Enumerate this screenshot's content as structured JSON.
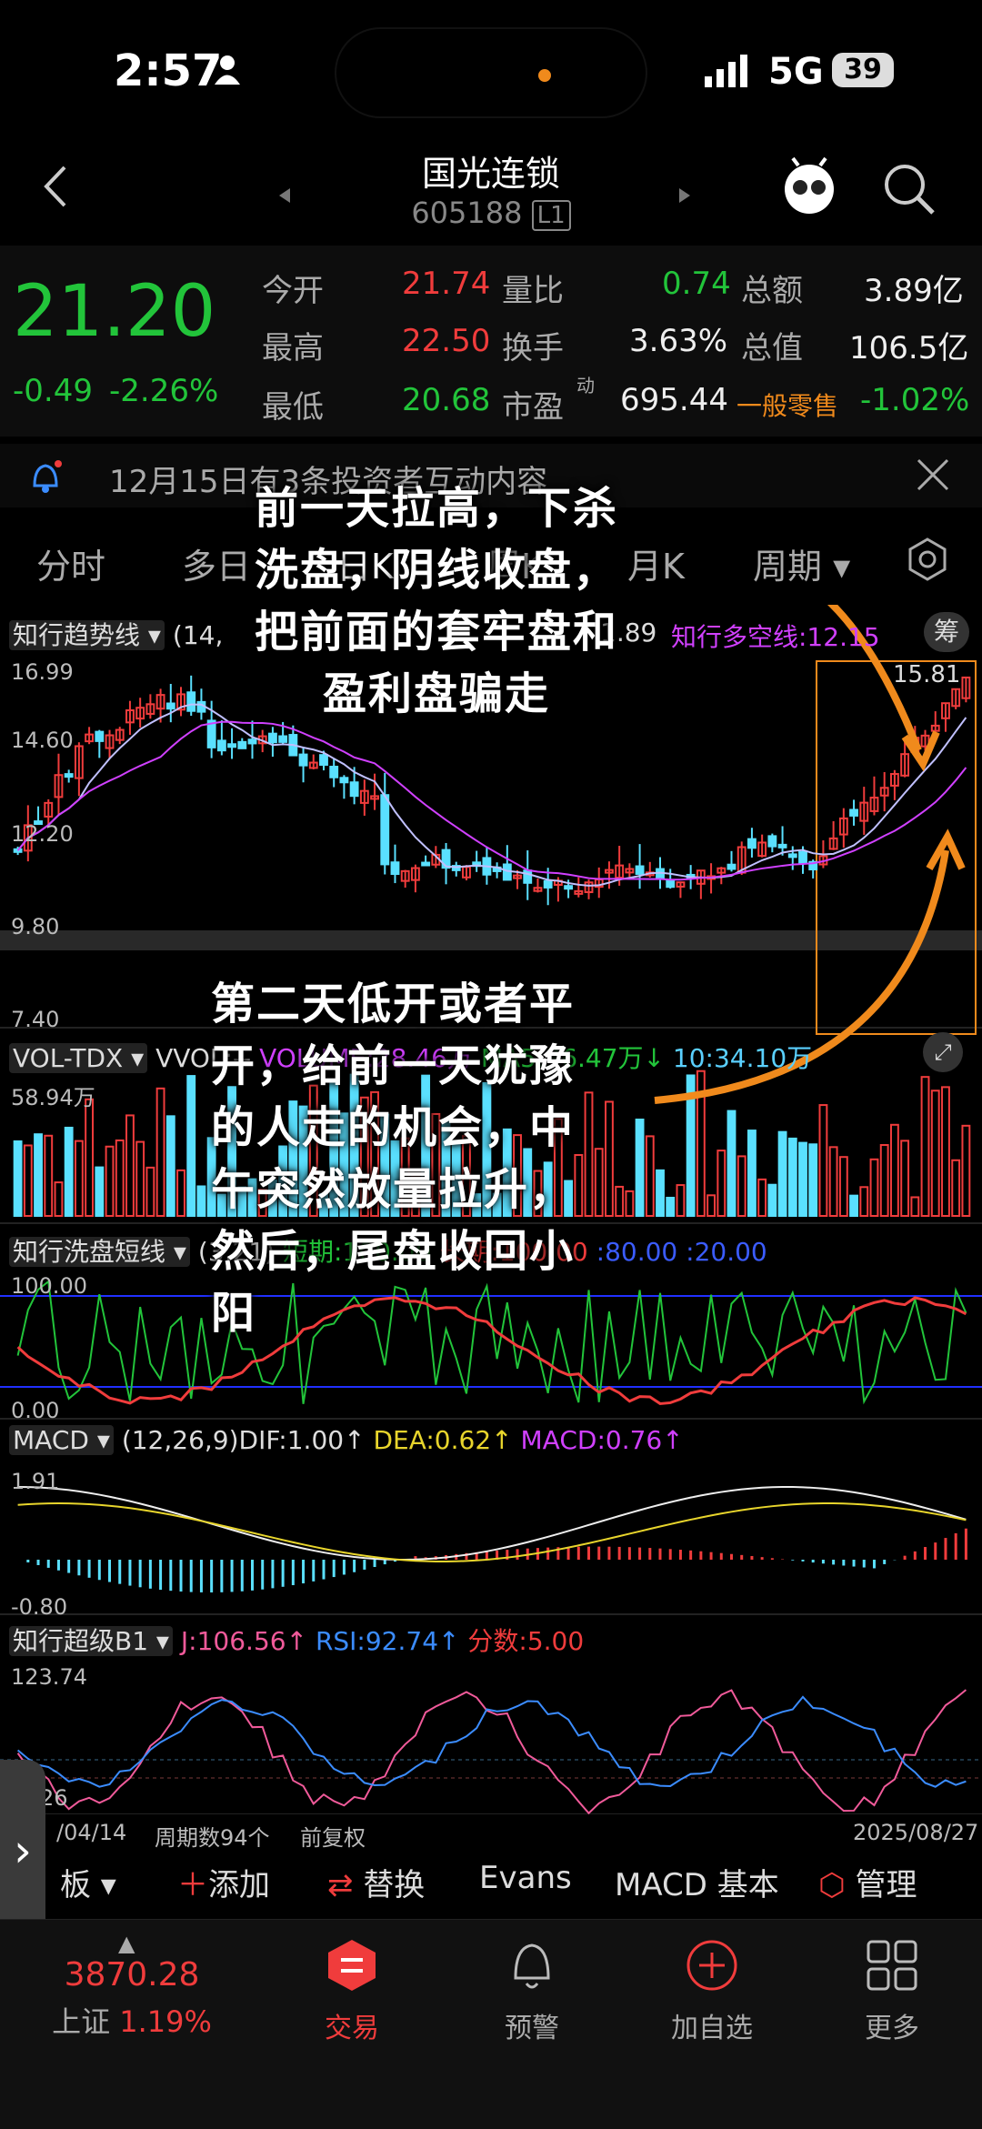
{
  "status": {
    "time": "2:57",
    "network": "5G",
    "battery": "39"
  },
  "header": {
    "title": "国光连锁",
    "code": "605188",
    "level": "L1"
  },
  "quote": {
    "price": "21.20",
    "change": "-0.49",
    "change_pct": "-2.26%",
    "rows": [
      {
        "l1": "今开",
        "v1": "21.74",
        "l2": "量比",
        "v2": "0.74",
        "l3": "总额",
        "v3": "3.89亿"
      },
      {
        "l1": "最高",
        "v1": "22.50",
        "l2": "换手",
        "v2": "3.63%",
        "l3": "总值",
        "v3": "106.5亿"
      },
      {
        "l1": "最低",
        "v1": "20.68",
        "l2": "市盈",
        "v2": "695.44",
        "l3": "一般零售",
        "v3": "-1.02%"
      }
    ],
    "pe_sup": "动"
  },
  "notice": {
    "text": "12月15日有3条投资者互动内容"
  },
  "tabs": [
    "分时",
    "多日",
    "日K",
    "周K",
    "月K",
    "周期"
  ],
  "indicators": {
    "main": {
      "name": "知行趋势线",
      "params": "(14,",
      "vals": "知行多空线:12.15",
      "mid": "1.89"
    },
    "main_axis": [
      "16.99",
      "14.60",
      "12.20",
      "9.80",
      "7.40"
    ],
    "main_high": "15.81",
    "vol": {
      "name": "VOL-TDX",
      "v1": "VVOL:--",
      "v2": "VOLUME:28.46万",
      "v3": "MA5:36.47万↓",
      "v4": "10:34.10万"
    },
    "vol_axis": "58.94万",
    "wash": {
      "name": "知行洗盘短线",
      "params": "(3,21)",
      "v1": "短期:100.00",
      "v2": "长期:100.00",
      "v3": ":80.00",
      "v4": ":20.00"
    },
    "wash_axis": [
      "100.00",
      "0.00"
    ],
    "macd": {
      "name": "MACD",
      "params": "(12,26,9)",
      "v1": "DIF:1.00↑",
      "v2": "DEA:0.62↑",
      "v3": "MACD:0.76↑"
    },
    "macd_axis": [
      "1.91",
      "-0.80"
    ],
    "b1": {
      "name": "知行超级B1",
      "v1": "J:106.56↑",
      "v2": "RSI:92.74↑",
      "v3": "分数:5.00"
    },
    "b1_axis": [
      "123.74",
      "26"
    ],
    "footer": {
      "start": "/04/14",
      "period": "周期数94个",
      "adj": "前复权",
      "end": "2025/08/27"
    },
    "side_btn": "筹"
  },
  "toolbar": {
    "t1": "板",
    "t2": "添加",
    "t3": "替换",
    "t4": "Evans",
    "t5": "MACD 基本",
    "t6": "管理"
  },
  "nav": {
    "index_val": "3870.28",
    "index_name": "上证",
    "index_pct": "1.19%",
    "trade": "交易",
    "alert": "预警",
    "watch": "加自选",
    "more": "更多"
  },
  "annotations": {
    "a1": [
      "前一天拉高，下杀",
      "洗盘，阴线收盘，",
      "把前面的套牢盘和",
      "盈利盘骗走"
    ],
    "a2": [
      "第二天低开或者平",
      "开，给前一天犹豫",
      "的人走的机会，中",
      "午突然放量拉升，",
      "然后，尾盘收回小",
      "阳"
    ]
  }
}
